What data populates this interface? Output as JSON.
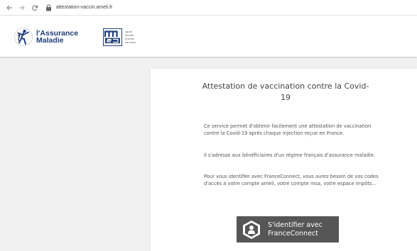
{
  "browser": {
    "url": "attestation-vaccin.ameli.fr",
    "icons": [
      "back-arrow-icon",
      "forward-arrow-icon",
      "reload-icon",
      "lock-icon"
    ]
  },
  "header": {
    "assurance_logo": {
      "line1": "l'Assurance",
      "line2": "Maladie"
    },
    "msa_logo": {
      "words": [
        "santé",
        "famille",
        "retraite",
        "services"
      ]
    }
  },
  "main": {
    "title": "Attestation de vaccination contre la Covid-19",
    "paragraphs": [
      "Ce service permet d'obtenir facilement une attestation de vaccination contre la Covid-19 après chaque injection reçue en France.",
      "Il s'adresse aux bénéficiaires d'un régime français d'assurance maladie.",
      "Pour vous identifier avec FranceConnect, vous aurez besoin de vos codes d'accès à votre compte ameli, votre compte msa, votre espace impôts..."
    ],
    "franceconnect_button": {
      "line1": "S'identifier avec",
      "line2": "FranceConnect"
    }
  },
  "colors": {
    "page_background": "#f1f1f1",
    "brand_blue": "#1f3f7a",
    "franceconnect_button": "#565656"
  }
}
